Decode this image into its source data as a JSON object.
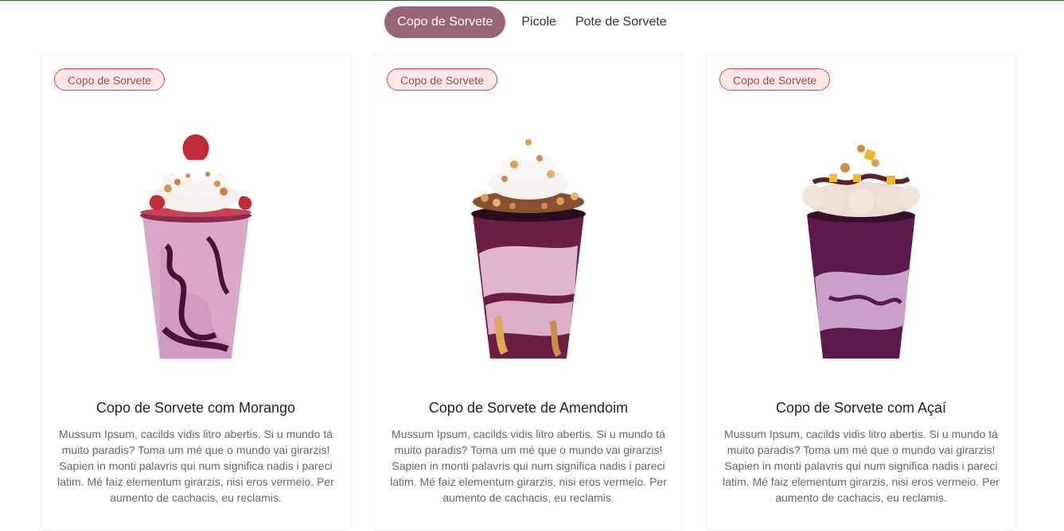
{
  "tabs": [
    {
      "label": "Copo de Sorvete",
      "active": true
    },
    {
      "label": "Picole",
      "active": false
    },
    {
      "label": "Pote de Sorvete",
      "active": false
    }
  ],
  "colors": {
    "accent": "#9a6478",
    "badge_border": "#c74b4b",
    "badge_bg": "#fde8e8"
  },
  "products": [
    {
      "badge": "Copo de Sorvete",
      "title": "Copo de Sorvete com Morango",
      "description": "Mussum Ipsum, cacilds vidis litro abertis. Si u mundo tá muito paradis? Toma um mé que o mundo vai girarzis! Sapien in monti palavris qui num significa nadis i pareci latim. Mé faiz elementum girarzis, nisi eros vermeio. Per aumento de cachacis, eu reclamis.",
      "image_icon": "strawberry-cup-icon"
    },
    {
      "badge": "Copo de Sorvete",
      "title": "Copo de Sorvete de Amendoim",
      "description": "Mussum Ipsum, cacilds vidis litro abertis. Si u mundo tá muito paradis? Toma um mé que o mundo vai girarzis! Sapien in monti palavris qui num significa nadis i pareci latim. Mé faiz elementum girarzis, nisi eros vermeio. Per aumento de cachacis, eu reclamis.",
      "image_icon": "peanut-cup-icon"
    },
    {
      "badge": "Copo de Sorvete",
      "title": "Copo de Sorvete com Açaí",
      "description": "Mussum Ipsum, cacilds vidis litro abertis. Si u mundo tá muito paradis? Toma um mé que o mundo vai girarzis! Sapien in monti palavris qui num significa nadis i pareci latim. Mé faiz elementum girarzis, nisi eros vermeio. Per aumento de cachacis, eu reclamis.",
      "image_icon": "acai-cup-icon"
    }
  ]
}
